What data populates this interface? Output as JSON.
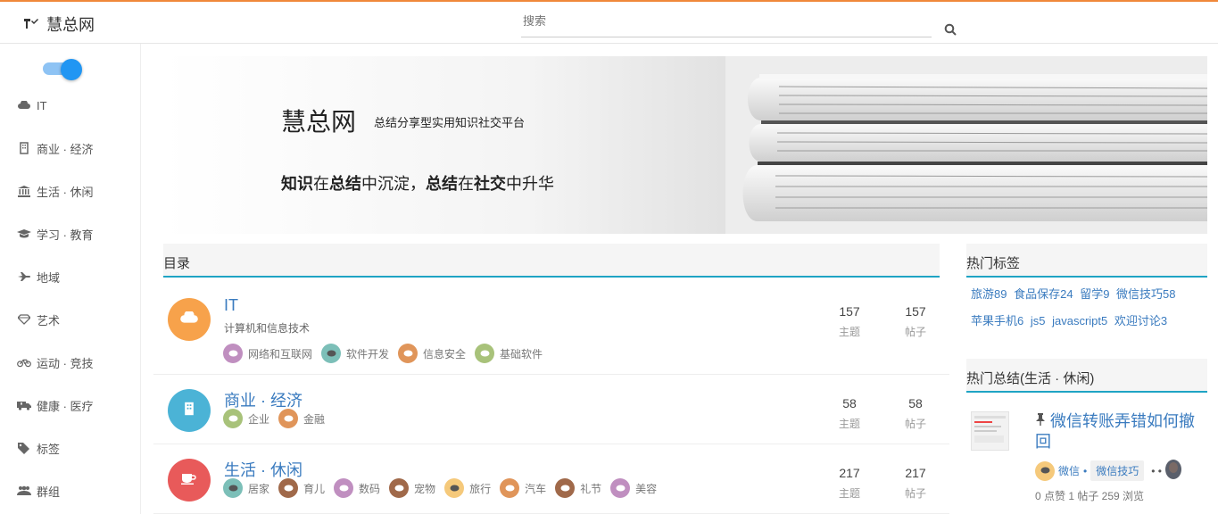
{
  "header": {
    "site_name": "慧总网",
    "search_placeholder": "搜索"
  },
  "sidebar": {
    "items": [
      {
        "label": "IT",
        "icon": "cloud-icon"
      },
      {
        "label": "商业 · 经济",
        "icon": "building-icon"
      },
      {
        "label": "生活 · 休闲",
        "icon": "bank-icon"
      },
      {
        "label": "学习 · 教育",
        "icon": "graduation-cap-icon"
      },
      {
        "label": "地域",
        "icon": "plane-icon"
      },
      {
        "label": "艺术",
        "icon": "diamond-icon"
      },
      {
        "label": "运动 · 竞技",
        "icon": "bicycle-icon"
      },
      {
        "label": "健康 · 医疗",
        "icon": "ambulance-icon"
      },
      {
        "label": "标签",
        "icon": "tags-icon"
      },
      {
        "label": "群组",
        "icon": "users-icon"
      }
    ]
  },
  "banner": {
    "title": "慧总网",
    "subtitle": "总结分享型实用知识社交平台",
    "slogan_parts": [
      "知识",
      "在",
      "总结",
      "中沉淀，",
      "总结",
      "在",
      "社交",
      "中升华"
    ]
  },
  "catalog": {
    "heading": "目录",
    "categories": [
      {
        "title": "IT",
        "desc": "计算机和信息技术",
        "color": "#f7a24b",
        "topics": "157",
        "topics_label": "主题",
        "posts": "157",
        "posts_label": "帖子",
        "tags": [
          {
            "label": "网络和互联网",
            "color": "#c08fc0"
          },
          {
            "label": "软件开发",
            "color": "#7cbfb8"
          },
          {
            "label": "信息安全",
            "color": "#e0955a"
          },
          {
            "label": "基础软件",
            "color": "#a8c27a"
          }
        ]
      },
      {
        "title": "商业 · 经济",
        "desc": "",
        "color": "#4bb3d6",
        "topics": "58",
        "topics_label": "主题",
        "posts": "58",
        "posts_label": "帖子",
        "tags": [
          {
            "label": "企业",
            "color": "#a8c27a"
          },
          {
            "label": "金融",
            "color": "#e0955a"
          }
        ]
      },
      {
        "title": "生活 · 休闲",
        "desc": "",
        "color": "#e85a5a",
        "topics": "217",
        "topics_label": "主题",
        "posts": "217",
        "posts_label": "帖子",
        "tags": [
          {
            "label": "居家",
            "color": "#7cbfb8"
          },
          {
            "label": "育儿",
            "color": "#a0694a"
          },
          {
            "label": "数码",
            "color": "#c08fc0"
          },
          {
            "label": "宠物",
            "color": "#a0694a"
          },
          {
            "label": "旅行",
            "color": "#f5c97b"
          },
          {
            "label": "汽车",
            "color": "#e0955a"
          },
          {
            "label": "礼节",
            "color": "#a0694a"
          },
          {
            "label": "美容",
            "color": "#c08fc0"
          }
        ]
      }
    ]
  },
  "hot_tags": {
    "heading": "热门标签",
    "line1": [
      "旅游89",
      "食品保存24",
      "留学9",
      "微信技巧58"
    ],
    "line2": [
      "苹果手机6",
      "js5",
      "javascript5",
      "欢迎讨论3"
    ]
  },
  "hot_summary": {
    "heading": "热门总结(生活 · 休闲)",
    "post_title": "微信转账弄错如何撤回",
    "category": "微信",
    "separator": "•",
    "tag": "微信技巧",
    "stats": "0 点赞 1 帖子 259 浏览"
  }
}
